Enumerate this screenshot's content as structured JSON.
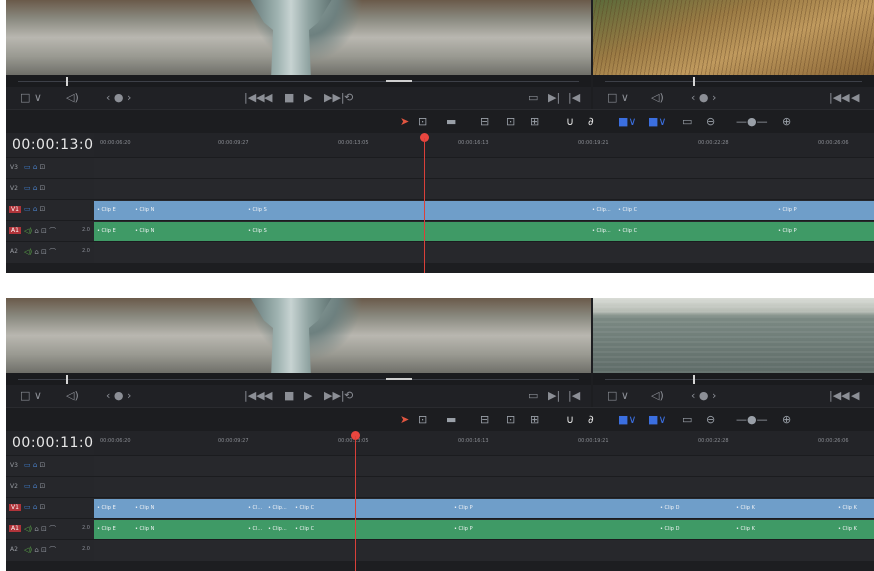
{
  "colors": {
    "video_clip": "#6f9ec9",
    "audio_clip": "#3f9a66",
    "playhead": "#d9403a",
    "panel_bg": "#1d1e21"
  },
  "icons": {
    "viewer_mode": "□ ∨",
    "audio": "◁)",
    "jog": "‹ ● ›",
    "transport": [
      "|◀◀",
      "◀",
      "■",
      "▶",
      "▶▶|",
      "⟲"
    ],
    "transport_right": [
      "▭",
      "▶|",
      "|◀"
    ],
    "tools": [
      "pointer",
      "trim",
      "blade",
      "razor",
      "insert",
      "overwrite",
      "replace",
      "snapping",
      "linking",
      "flag",
      "marker",
      "zoom"
    ]
  },
  "tracks": [
    {
      "name": "V3",
      "type": "video"
    },
    {
      "name": "V2",
      "type": "video"
    },
    {
      "name": "V1",
      "type": "video",
      "active": true
    },
    {
      "name": "A1",
      "type": "audio",
      "active": true,
      "level": "2.0"
    },
    {
      "name": "A2",
      "type": "audio",
      "level": "2.0"
    }
  ],
  "ruler_ticks": [
    "00:00:06:20",
    "00:00:09:27",
    "00:00:13:05",
    "00:00:16:13",
    "00:00:19:21",
    "00:00:22:28",
    "00:00:26:06"
  ],
  "panels": [
    {
      "timecode": "00:00:13:05",
      "v1_clips": [
        {
          "label": "• Clip E"
        },
        {
          "label": "• Clip N"
        },
        {
          "label": "• Clip S"
        },
        {
          "label": ""
        },
        {
          "label": "• Clip..."
        },
        {
          "label": "• Clip C"
        },
        {
          "label": "• Clip P"
        }
      ],
      "a1_clips": [
        {
          "label": "• Clip E"
        },
        {
          "label": "• Clip N"
        },
        {
          "label": "• Clip S"
        },
        {
          "label": ""
        },
        {
          "label": "• Clip..."
        },
        {
          "label": "• Clip C"
        },
        {
          "label": "• Clip P"
        }
      ]
    },
    {
      "timecode": "00:00:11:09",
      "v1_clips": [
        {
          "label": "• Clip E"
        },
        {
          "label": "• Clip N"
        },
        {
          "label": "• Cl..."
        },
        {
          "label": "• Clip..."
        },
        {
          "label": "• Clip C"
        },
        {
          "label": "• Clip P"
        },
        {
          "label": "• Clip D"
        },
        {
          "label": "• Clip K"
        },
        {
          "label": "• Clip K"
        }
      ],
      "a1_clips": [
        {
          "label": "• Clip E"
        },
        {
          "label": "• Clip N"
        },
        {
          "label": "• Cl..."
        },
        {
          "label": "• Clip..."
        },
        {
          "label": "• Clip C"
        },
        {
          "label": "• Clip P"
        },
        {
          "label": "• Clip D"
        },
        {
          "label": "• Clip K"
        },
        {
          "label": "• Clip K"
        }
      ]
    }
  ]
}
